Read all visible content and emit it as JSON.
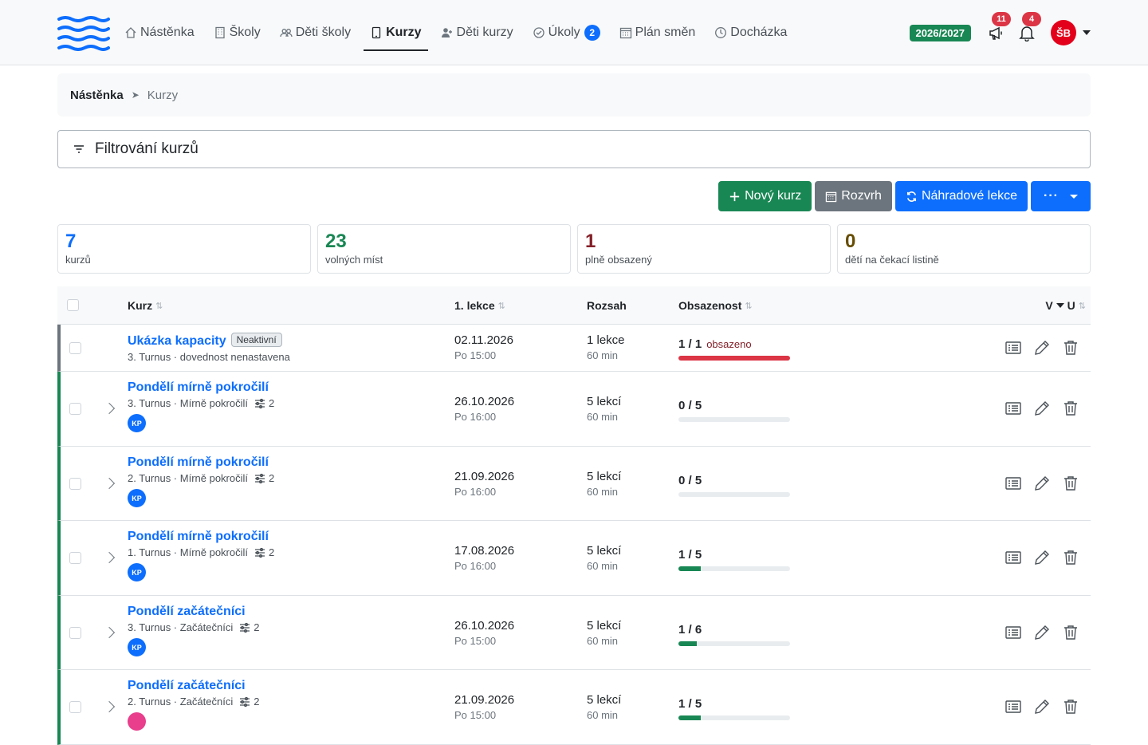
{
  "nav": {
    "items": [
      {
        "label": "Nástěnka"
      },
      {
        "label": "Školy"
      },
      {
        "label": "Děti školy"
      },
      {
        "label": "Kurzy"
      },
      {
        "label": "Děti kurzy"
      },
      {
        "label": "Úkoly",
        "badge": "2"
      },
      {
        "label": "Plán směn"
      },
      {
        "label": "Docházka"
      }
    ],
    "school_year": "2026/2027",
    "announcements_count": "11",
    "notifications_count": "4",
    "user_initials": "ŠB"
  },
  "breadcrumb": {
    "home": "Nástěnka",
    "current": "Kurzy"
  },
  "filter": {
    "label": "Filtrování kurzů"
  },
  "toolbar": {
    "new_course": "Nový kurz",
    "schedule": "Rozvrh",
    "replacement": "Náhradové lekce",
    "more": "···"
  },
  "stats": [
    {
      "value": "7",
      "label": "kurzů",
      "color": "#0d6efd"
    },
    {
      "value": "23",
      "label": "volných míst",
      "color": "#198754"
    },
    {
      "value": "1",
      "label": "plně obsazený",
      "color": "#842029"
    },
    {
      "value": "0",
      "label": "dětí na čekací listině",
      "color": "#664d03"
    }
  ],
  "table": {
    "headers": {
      "course": "Kurz",
      "first_lesson": "1. lekce",
      "range": "Rozsah",
      "occupancy": "Obsazenost",
      "vu": "V",
      "u": "U"
    },
    "rows": [
      {
        "name": "Ukázka kapacity",
        "badge": "Neaktivní",
        "sub": "3. Turnus · dovednost nenastavena",
        "date": "02.11.2026",
        "time": "Po 15:00",
        "lessons": "1 lekce",
        "duration": "60 min",
        "occupancy": "1 / 1",
        "occupied_label": "obsazeno",
        "fill": 1.0
      },
      {
        "name": "Pondělí mírně pokročilí",
        "sub": "3. Turnus · Mírně pokročilí",
        "skills": "2",
        "trainer": "KP",
        "date": "26.10.2026",
        "time": "Po 16:00",
        "lessons": "5 lekcí",
        "duration": "60 min",
        "occupancy": "0 / 5",
        "fill": 0.0
      },
      {
        "name": "Pondělí mírně pokročilí",
        "sub": "2. Turnus · Mírně pokročilí",
        "skills": "2",
        "trainer": "KP",
        "date": "21.09.2026",
        "time": "Po 16:00",
        "lessons": "5 lekcí",
        "duration": "60 min",
        "occupancy": "0 / 5",
        "fill": 0.0
      },
      {
        "name": "Pondělí mírně pokročilí",
        "sub": "1. Turnus · Mírně pokročilí",
        "skills": "2",
        "trainer": "KP",
        "date": "17.08.2026",
        "time": "Po 16:00",
        "lessons": "5 lekcí",
        "duration": "60 min",
        "occupancy": "1 / 5",
        "fill": 0.2
      },
      {
        "name": "Pondělí začátečníci",
        "sub": "3. Turnus · Začátečníci",
        "skills": "2",
        "trainer": "KP",
        "date": "26.10.2026",
        "time": "Po 15:00",
        "lessons": "5 lekcí",
        "duration": "60 min",
        "occupancy": "1 / 6",
        "fill": 0.1667
      },
      {
        "name": "Pondělí začátečníci",
        "sub": "2. Turnus · Začátečníci",
        "skills": "2",
        "date": "21.09.2026",
        "time": "Po 15:00",
        "lessons": "5 lekcí",
        "duration": "60 min",
        "occupancy": "1 / 5",
        "fill": 0.2
      }
    ]
  }
}
